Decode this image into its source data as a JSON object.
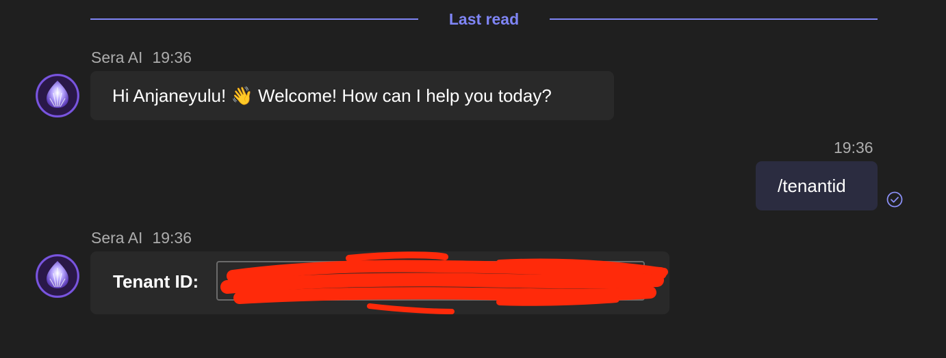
{
  "divider": {
    "label": "Last read",
    "color": "#7f85f5"
  },
  "messages": [
    {
      "sender": "Sera AI",
      "time": "19:36",
      "text": "Hi Anjaneyulu! 👋 Welcome! How can I help you today?",
      "avatar_icon": "sera-ai-logo-icon"
    },
    {
      "sender": "",
      "time": "19:36",
      "text": "/tenantid",
      "status_icon": "sent-check-icon"
    },
    {
      "sender": "Sera AI",
      "time": "19:36",
      "card": {
        "label": "Tenant ID:",
        "value": "",
        "redacted": true
      },
      "avatar_icon": "sera-ai-logo-icon"
    }
  ],
  "colors": {
    "background": "#1f1f1f",
    "bubble": "#292929",
    "self_bubble": "#2b2c40",
    "accent": "#7f85f5",
    "redaction": "#ff2a0a"
  }
}
